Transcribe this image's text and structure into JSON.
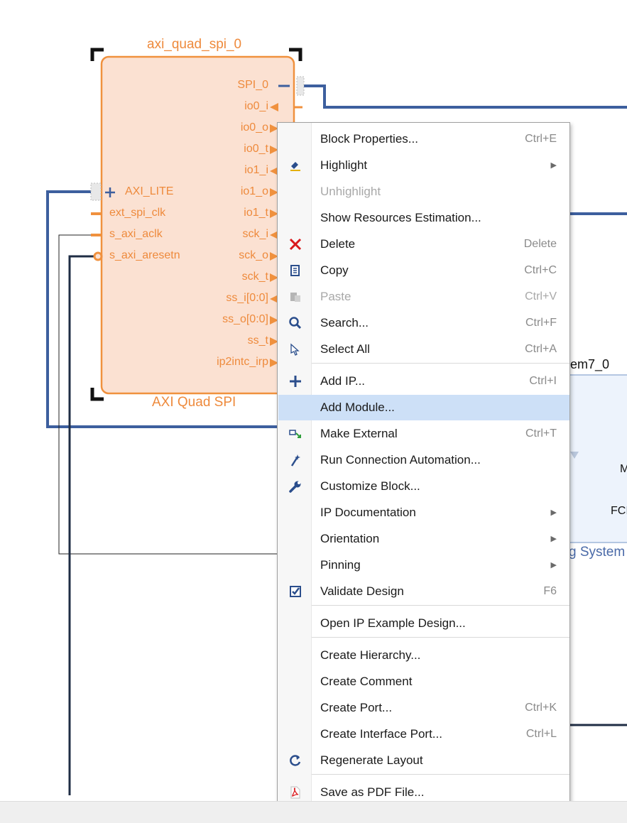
{
  "ip_block": {
    "instance_name": "axi_quad_spi_0",
    "type_name": "AXI Quad SPI",
    "right_ports": [
      "SPI_0",
      "io0_i",
      "io0_o",
      "io0_t",
      "io1_i",
      "io1_o",
      "io1_t",
      "sck_i",
      "sck_o",
      "sck_t",
      "ss_i[0:0]",
      "ss_o[0:0]",
      "ss_t",
      "ip2intc_irp"
    ],
    "left_ports": [
      "AXI_LITE",
      "ext_spi_clk",
      "s_axi_aclk",
      "s_axi_aresetn"
    ]
  },
  "zynq_block": {
    "instance_name_fragment": "em7_0",
    "port_fragment_1": "M",
    "port_fragment_2": "FCI",
    "type_fragment": "g System"
  },
  "context_menu": {
    "items": [
      {
        "label": "Block Properties...",
        "shortcut": "Ctrl+E",
        "icon": ""
      },
      {
        "label": "Highlight",
        "shortcut": "",
        "icon": "highlight-icon",
        "submenu": true
      },
      {
        "label": "Unhighlight",
        "shortcut": "",
        "icon": "",
        "disabled": true
      },
      {
        "label": "Show Resources Estimation...",
        "shortcut": "",
        "icon": ""
      },
      {
        "label": "Delete",
        "shortcut": "Delete",
        "icon": "delete-icon"
      },
      {
        "label": "Copy",
        "shortcut": "Ctrl+C",
        "icon": "copy-icon"
      },
      {
        "label": "Paste",
        "shortcut": "Ctrl+V",
        "icon": "paste-icon",
        "disabled": true
      },
      {
        "label": "Search...",
        "shortcut": "Ctrl+F",
        "icon": "search-icon"
      },
      {
        "label": "Select All",
        "shortcut": "Ctrl+A",
        "icon": "select-all-icon"
      },
      {
        "label": "Add IP...",
        "shortcut": "Ctrl+I",
        "icon": "plus-icon"
      },
      {
        "label": "Add Module...",
        "shortcut": "",
        "icon": "",
        "highlighted": true
      },
      {
        "label": "Make External",
        "shortcut": "Ctrl+T",
        "icon": "make-external-icon"
      },
      {
        "label": "Run Connection Automation...",
        "shortcut": "",
        "icon": "wand-icon"
      },
      {
        "label": "Customize Block...",
        "shortcut": "",
        "icon": "wrench-icon"
      },
      {
        "label": "IP Documentation",
        "shortcut": "",
        "icon": "",
        "submenu": true
      },
      {
        "label": "Orientation",
        "shortcut": "",
        "icon": "",
        "submenu": true
      },
      {
        "label": "Pinning",
        "shortcut": "",
        "icon": "",
        "submenu": true
      },
      {
        "label": "Validate Design",
        "shortcut": "F6",
        "icon": "validate-icon"
      },
      {
        "label": "Open IP Example Design...",
        "shortcut": "",
        "icon": ""
      },
      {
        "label": "Create Hierarchy...",
        "shortcut": "",
        "icon": ""
      },
      {
        "label": "Create Comment",
        "shortcut": "",
        "icon": ""
      },
      {
        "label": "Create Port...",
        "shortcut": "Ctrl+K",
        "icon": ""
      },
      {
        "label": "Create Interface Port...",
        "shortcut": "Ctrl+L",
        "icon": ""
      },
      {
        "label": "Regenerate Layout",
        "shortcut": "",
        "icon": "refresh-icon"
      },
      {
        "label": "Save as PDF File...",
        "shortcut": "",
        "icon": "pdf-icon"
      }
    ]
  }
}
